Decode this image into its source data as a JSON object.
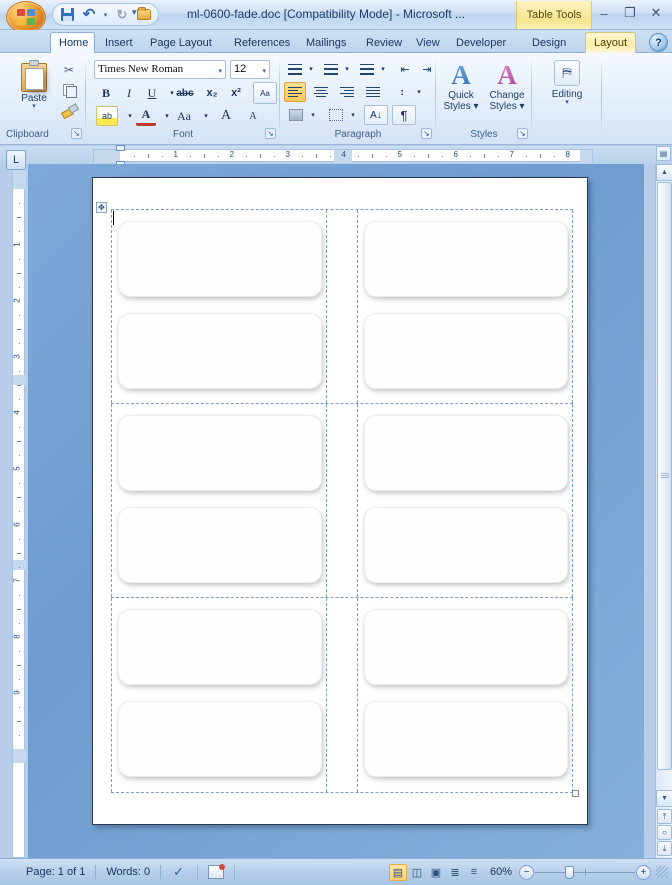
{
  "window": {
    "title": "ml-0600-fade.doc [Compatibility Mode] - Microsoft ...",
    "contextual_tab_group": "Table Tools",
    "minimize": "–",
    "maximize": "❐",
    "close": "✕",
    "office_button": "office-orb"
  },
  "quick_access": {
    "save": "Save",
    "undo": "↶",
    "undo_caret": "▾",
    "redo": "↻",
    "open": "Open",
    "customize_caret": "☰"
  },
  "tabs": [
    {
      "label": "Home",
      "active": true
    },
    {
      "label": "Insert",
      "active": false
    },
    {
      "label": "Page Layout",
      "active": false
    },
    {
      "label": "References",
      "active": false
    },
    {
      "label": "Mailings",
      "active": false
    },
    {
      "label": "Review",
      "active": false
    },
    {
      "label": "View",
      "active": false
    },
    {
      "label": "Developer",
      "active": false
    },
    {
      "label": "Design",
      "active": false,
      "contextual": true
    },
    {
      "label": "Layout",
      "active": true,
      "contextual": true
    }
  ],
  "help": {
    "label": "?"
  },
  "ribbon": {
    "groups": [
      {
        "name": "Clipboard",
        "label": "Clipboard"
      },
      {
        "name": "Font",
        "label": "Font"
      },
      {
        "name": "Paragraph",
        "label": "Paragraph"
      },
      {
        "name": "Styles",
        "label": "Styles"
      },
      {
        "name": "Editing",
        "label": "Editing"
      }
    ],
    "clipboard": {
      "paste_label": "Paste",
      "paste_caret": "▾",
      "cut": "✂",
      "copy": "Copy",
      "format_painter": "Format Painter"
    },
    "font": {
      "font_name": "Times New Roman",
      "font_size": "12",
      "caret": "▾",
      "bold": "B",
      "italic": "I",
      "underline": "U",
      "strikethrough": "abc",
      "subscript": "x₂",
      "superscript": "x²",
      "clear_formatting": "Aa",
      "highlight": "ab",
      "font_color": "A",
      "change_case": "Aa",
      "grow_font": "A",
      "shrink_font": "A"
    },
    "paragraph": {
      "bullets": "≡",
      "numbering": "≡",
      "multilevel": "≡",
      "decrease_indent": "⇤",
      "increase_indent": "⇥",
      "align_left": "Align Left",
      "align_center": "Center",
      "align_right": "Align Right",
      "justify": "Justify",
      "line_spacing": "↕",
      "shading": "Shading",
      "borders": "Borders",
      "sort": "A↓",
      "show_marks": "¶"
    },
    "styles": {
      "quick_styles_line1": "Quick",
      "quick_styles_line2": "Styles",
      "change_styles_line1": "Change",
      "change_styles_line2": "Styles",
      "caret": "▾",
      "glyph": "A"
    },
    "editing": {
      "label": "Editing",
      "caret": "▾",
      "find_glyph": "⛿"
    },
    "dialog_launcher": "↘"
  },
  "ruler": {
    "tab_stop_marker": "L",
    "horizontal_numbers": [
      "1",
      "2",
      "3",
      "4",
      "5",
      "6",
      "7",
      "8"
    ],
    "vertical_numbers": [
      "1",
      "2",
      "3",
      "4",
      "5",
      "6",
      "7",
      "8",
      "9"
    ]
  },
  "document": {
    "page_background": "#ffffff",
    "table_move_handle": "✥",
    "table_resize_handle": "resize",
    "rows": 3,
    "columns": 2,
    "labels_per_cell": 2,
    "total_labels": 12
  },
  "scrollbar": {
    "up_arrow": "▲",
    "down_arrow": "▼",
    "previous_page": "⤒",
    "select_browse_object": "○",
    "next_page": "⤓",
    "view_ruler": "▤"
  },
  "statusbar": {
    "page_info": "Page: 1 of 1",
    "word_count": "Words: 0",
    "proofing_icon": "proofing-errors-icon",
    "language_icon": "language-icon",
    "views": [
      {
        "name": "print-layout",
        "glyph": "▤",
        "active": true
      },
      {
        "name": "full-screen-reading",
        "glyph": "◫",
        "active": false
      },
      {
        "name": "web-layout",
        "glyph": "▣",
        "active": false
      },
      {
        "name": "outline",
        "glyph": "≣",
        "active": false
      },
      {
        "name": "draft",
        "glyph": "≡",
        "active": false
      }
    ],
    "zoom_level": "60%",
    "zoom_out": "−",
    "zoom_in": "+"
  },
  "colors": {
    "accent_blue": "#1b3d6b",
    "ribbon_bg": "#e4eefa",
    "contextual_yellow": "#f7e48f",
    "page_white": "#ffffff",
    "canvas_blue": "#6e9ccf",
    "gridline_blue": "#7b9dc4"
  }
}
